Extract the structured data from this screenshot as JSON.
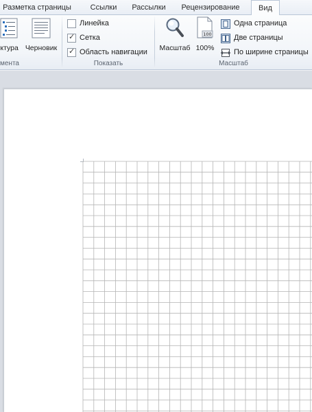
{
  "tabs": [
    {
      "label": "Разметка страницы",
      "active": false
    },
    {
      "label": "Ссылки",
      "active": false
    },
    {
      "label": "Рассылки",
      "active": false
    },
    {
      "label": "Рецензирование",
      "active": false
    },
    {
      "label": "Вид",
      "active": true
    }
  ],
  "ribbon": {
    "document_views": {
      "group_label": "мента",
      "outline_label": "уктура",
      "draft_label": "Черновик"
    },
    "show": {
      "group_label": "Показать",
      "items": [
        {
          "label": "Линейка",
          "checked": false
        },
        {
          "label": "Сетка",
          "checked": true
        },
        {
          "label": "Область навигации",
          "checked": true
        }
      ]
    },
    "zoom": {
      "group_label": "Масштаб",
      "zoom_label": "Масштаб",
      "hundred_label": "100%",
      "hundred_icon_text": "100",
      "one_page": "Одна страница",
      "two_pages": "Две страницы",
      "page_width": "По ширине страницы"
    }
  },
  "document": {
    "gridlines_visible": true,
    "grid_color": "#b4b4b4"
  },
  "colors": {
    "accent": "#2a6ebb",
    "ribbon_border": "#b9c6d6",
    "workspace": "#d9dde4"
  }
}
